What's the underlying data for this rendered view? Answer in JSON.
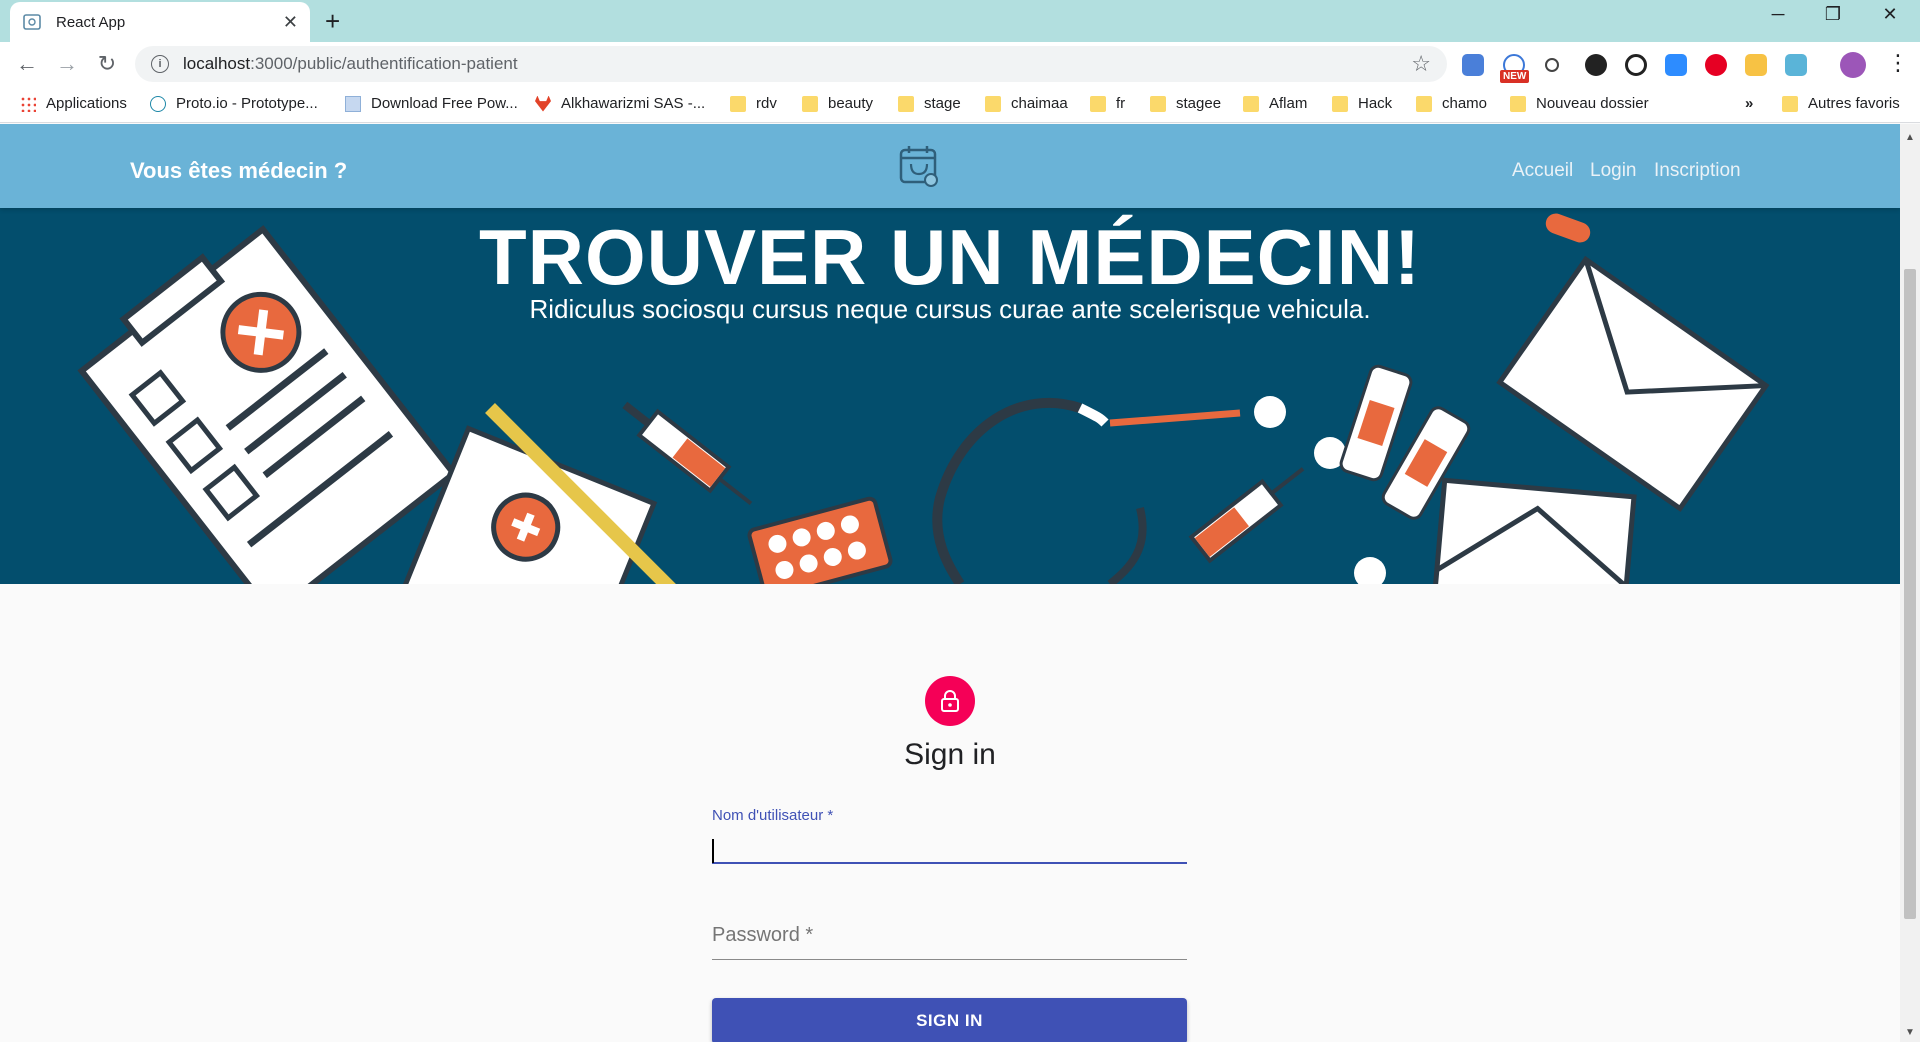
{
  "browser": {
    "tab_title": "React App",
    "url_host": "localhost",
    "url_path": ":3000/public/authentification-patient",
    "bookmarks": [
      {
        "label": "Applications",
        "icon": "apps-grid-icon"
      },
      {
        "label": "Proto.io - Prototype...",
        "icon": "proto-icon"
      },
      {
        "label": "Download Free Pow...",
        "icon": "page-icon"
      },
      {
        "label": "Alkhawarizmi SAS -...",
        "icon": "gitlab-icon"
      },
      {
        "label": "rdv",
        "icon": "folder-icon"
      },
      {
        "label": "beauty",
        "icon": "folder-icon"
      },
      {
        "label": "stage",
        "icon": "folder-icon"
      },
      {
        "label": "chaimaa",
        "icon": "folder-icon"
      },
      {
        "label": "fr",
        "icon": "folder-icon"
      },
      {
        "label": "stagee",
        "icon": "folder-icon"
      },
      {
        "label": "Aflam",
        "icon": "folder-icon"
      },
      {
        "label": "Hack",
        "icon": "folder-icon"
      },
      {
        "label": "chamo",
        "icon": "folder-icon"
      },
      {
        "label": "Nouveau dossier",
        "icon": "folder-icon"
      }
    ],
    "overflow": "»",
    "other_bookmarks": "Autres favoris",
    "ext_new_badge": "NEW"
  },
  "appbar": {
    "doctor_link": "Vous êtes médecin ?",
    "nav": [
      "Accueil",
      "Login",
      "Inscription"
    ]
  },
  "hero": {
    "title": "TROUVER UN MÉDECIN!",
    "subtitle": "Ridiculus sociosqu cursus neque cursus curae ante scelerisque vehicula."
  },
  "signin": {
    "title": "Sign in",
    "username_label": "Nom d'utilisateur *",
    "username_value": "",
    "password_label": "Password *",
    "password_value": "",
    "button": "SIGN IN"
  },
  "colors": {
    "appbar": "#6ab3d7",
    "hero": "#034e6d",
    "accent": "#3f51b5",
    "avatar": "#f50057"
  }
}
